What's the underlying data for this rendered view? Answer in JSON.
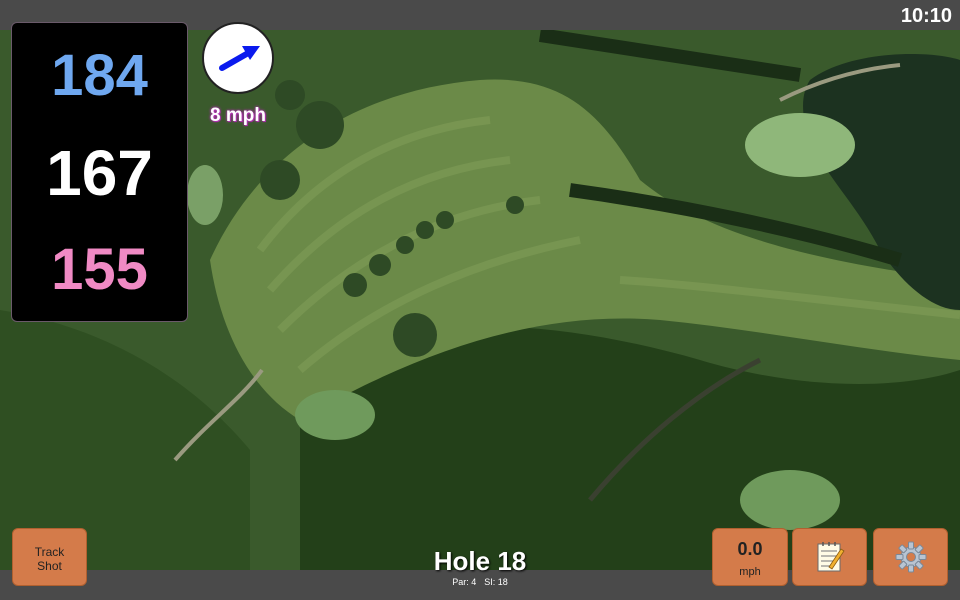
{
  "status": {
    "time": "10:10"
  },
  "yardages": {
    "back": "184",
    "middle": "167",
    "front": "155"
  },
  "wind": {
    "speed_label": "8 mph",
    "icon": "wind-arrow-icon",
    "direction": "east-northeast"
  },
  "hole": {
    "title": "Hole 18",
    "par": "Par: 4",
    "si": "SI: 18"
  },
  "buttons": {
    "track_shot": {
      "line1": "Track",
      "line2": "Shot"
    },
    "speed": {
      "value": "0.0",
      "unit": "mph"
    },
    "notes": {
      "icon": "notepad-icon"
    },
    "settings": {
      "icon": "gear-icon"
    }
  },
  "colors": {
    "back": "#6fa8f0",
    "middle": "#ffffff",
    "front": "#f08ac4",
    "button": "#d47b4a",
    "bar": "#4a4a4a",
    "wind_glow": "#b02fb0"
  }
}
